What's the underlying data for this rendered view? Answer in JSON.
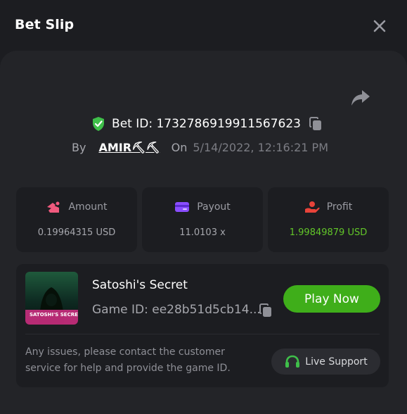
{
  "header": {
    "title": "Bet Slip",
    "close_icon": "close-icon"
  },
  "bet": {
    "share_icon": "share-icon",
    "verified_icon": "shield-check-icon",
    "id_label": "Bet ID: 1732786919911567623",
    "copy_icon": "copy-icon",
    "by_label": "By",
    "user": "AMIR⛏⛏",
    "on_label": "On",
    "date": "5/14/2022, 12:16:21 PM"
  },
  "stats": [
    {
      "label": "Amount",
      "value": "0.19964315 USD",
      "icon": "amount-icon",
      "icon_color": "#f05a7e"
    },
    {
      "label": "Payout",
      "value": "11.0103 x",
      "icon": "card-icon",
      "icon_color": "#8a4dff"
    },
    {
      "label": "Profit",
      "value": "1.99849879 USD",
      "icon": "profit-hand-icon",
      "icon_color": "#e8433a"
    }
  ],
  "game": {
    "thumbnail_text": "SATOSHI'S SECRET",
    "title": "Satoshi's Secret",
    "id_text": "Game ID: ee28b51d5cb14...",
    "play_label": "Play Now",
    "support_note": "Any issues, please contact the customer service for help and provide the game ID.",
    "support_label": "Live Support",
    "support_icon": "headset-icon"
  },
  "colors": {
    "background": "#1c1d21",
    "panel": "#232428",
    "accent_green": "#3fae1a",
    "profit_green": "#62c629"
  }
}
